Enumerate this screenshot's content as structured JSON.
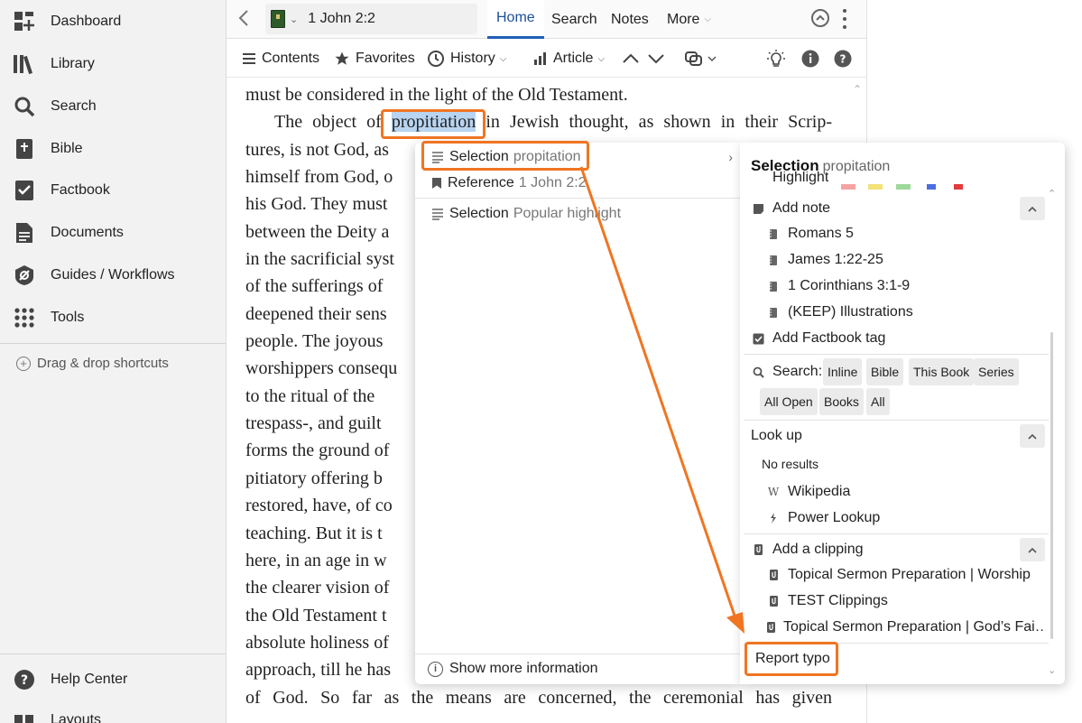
{
  "sidebar": {
    "items": [
      {
        "label": "Dashboard",
        "icon": "dashboard-icon"
      },
      {
        "label": "Library",
        "icon": "library-icon"
      },
      {
        "label": "Search",
        "icon": "search-icon"
      },
      {
        "label": "Bible",
        "icon": "bible-icon"
      },
      {
        "label": "Factbook",
        "icon": "factbook-icon"
      },
      {
        "label": "Documents",
        "icon": "documents-icon"
      },
      {
        "label": "Guides / Workflows",
        "icon": "guides-icon"
      },
      {
        "label": "Tools",
        "icon": "tools-icon"
      }
    ],
    "drag_drop": "Drag & drop shortcuts",
    "bottom_items": [
      {
        "label": "Help Center",
        "icon": "help-icon"
      },
      {
        "label": "Layouts",
        "icon": "layouts-icon"
      }
    ]
  },
  "topbar": {
    "reference": "1 John 2:2",
    "tabs": [
      "Home",
      "Search",
      "Notes",
      "More"
    ]
  },
  "toolbar": {
    "contents": "Contents",
    "favorites": "Favorites",
    "history": "History",
    "article": "Article"
  },
  "text": {
    "lines": [
      "must be considered in the light of the Old Testament.",
      "The object of",
      "propitiation",
      "in Jewish thought, as shown in their Scrip-",
      "tures, is not God, as",
      "himself from God, o",
      "his God. They must",
      "between the Deity a",
      "in the sacrificial syst",
      "of the sufferings of",
      "deepened their sens",
      "people. The joyous",
      "worshippers consequ",
      "to the ritual of the",
      "trespass-, and guilt",
      "forms the ground of",
      "pitiatory offering b",
      "restored, have, of co",
      "teaching. But it is t",
      "here, in an age in w",
      "the clearer vision of",
      "the Old Testament t",
      "absolute holiness of",
      "approach, till he has",
      "of God. So far as the means are concerned, the ceremonial has given"
    ]
  },
  "context_menu": {
    "left": {
      "items": [
        {
          "label": "Selection",
          "sub": "propitation"
        },
        {
          "label": "Reference",
          "sub": "1 John 2:2"
        },
        {
          "label": "Selection",
          "sub": "Popular highlight"
        }
      ],
      "footer": "Show more information"
    },
    "right": {
      "title": "Selection",
      "title_sub": "propitation",
      "highlight_label": "Highlight",
      "highlight_colors": [
        "#f4a3a3",
        "#f4e27a",
        "#9fd99a",
        "#4b6fe0",
        "#e23b3b"
      ],
      "add_note": "Add note",
      "notes": [
        "Romans 5",
        "James 1:22-25",
        "1 Corinthians 3:1-9",
        "(KEEP) Illustrations"
      ],
      "add_factbook_tag": "Add Factbook tag",
      "search_label": "Search:",
      "search_chips": [
        "Inline",
        "Bible",
        "This Book",
        "Series",
        "All Open",
        "Books",
        "All"
      ],
      "look_up": "Look up",
      "no_results": "No results",
      "lookups": [
        "Wikipedia",
        "Power Lookup"
      ],
      "add_clipping": "Add a clipping",
      "clippings": [
        "Topical Sermon Preparation | Worship",
        "TEST Clippings",
        "Topical Sermon Preparation | God’s Fai…"
      ],
      "report_typo": "Report typo"
    }
  },
  "colors": {
    "annotation": "#f07522",
    "accent": "#1f5fb8",
    "selection_highlight": "#b8d4f0"
  }
}
